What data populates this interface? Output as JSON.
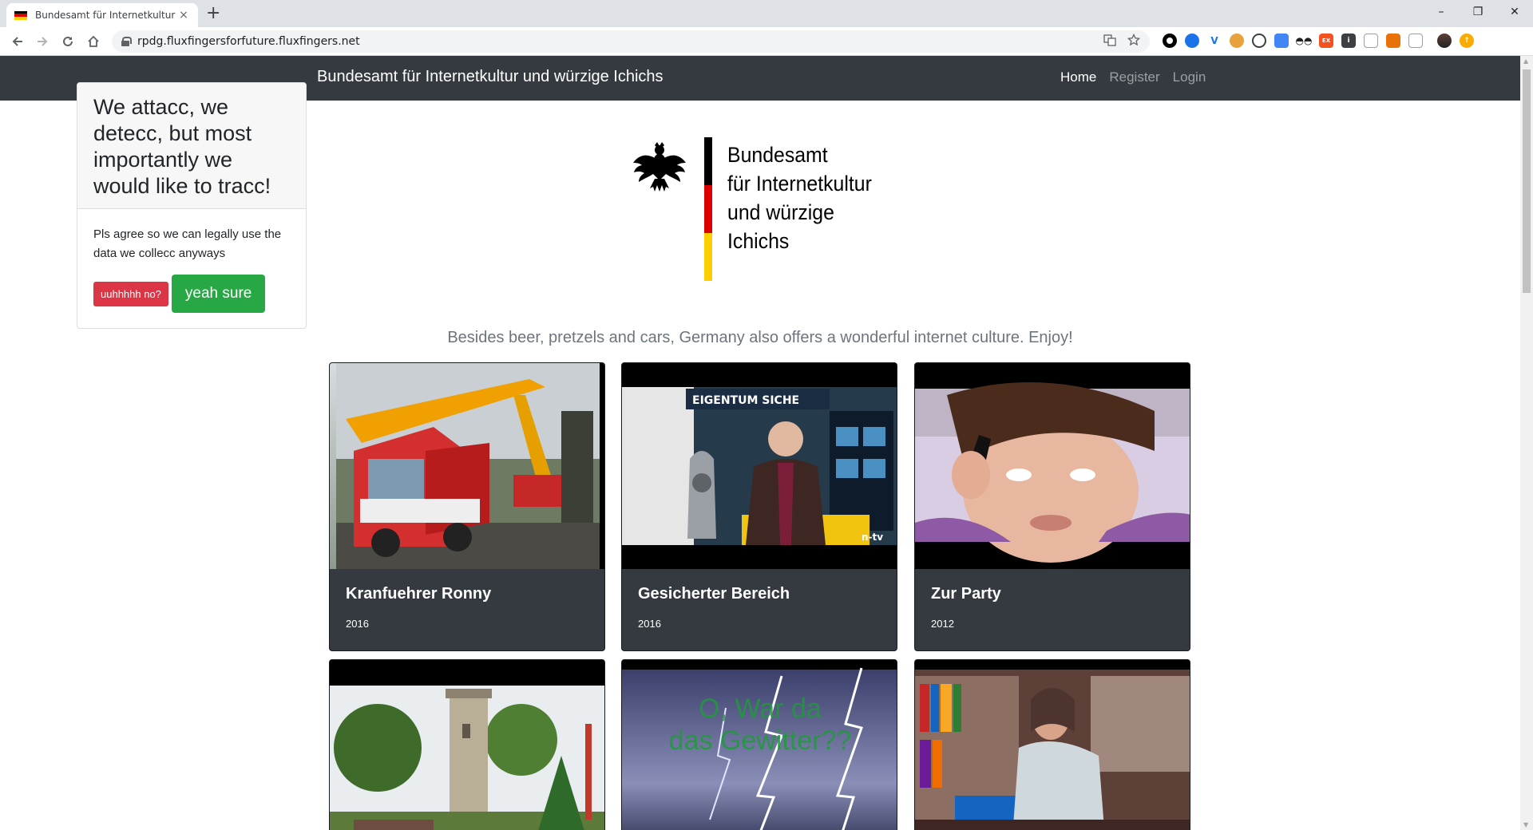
{
  "browser": {
    "tab_title": "Bundesamt für Internetkultur und würzige Ichichs",
    "tab_close": "×",
    "new_tab": "+",
    "url": "rpdg.fluxfingersforfuture.fluxfingers.net",
    "nav_icons": [
      "back-icon",
      "forward-icon",
      "reload-icon",
      "home-icon"
    ],
    "omnibox_icons": [
      "translate-icon",
      "bookmark-star-icon"
    ],
    "extensions": [
      {
        "name": "extension-circle-icon",
        "color": "#000000",
        "label": "○"
      },
      {
        "name": "extension-blue-circle-icon",
        "color": "#1a73e8",
        "label": "◉"
      },
      {
        "name": "extension-v-icon",
        "color": "#1a73e8",
        "label": "V"
      },
      {
        "name": "extension-cookie-icon",
        "color": "#e8a23b",
        "label": "●"
      },
      {
        "name": "extension-gear-icon",
        "color": "#3c4043",
        "label": "⚙"
      },
      {
        "name": "extension-translate-icon",
        "color": "#4285f4",
        "label": "G"
      },
      {
        "name": "extension-glasses-icon",
        "color": "#202124",
        "label": "◓"
      },
      {
        "name": "extension-ex-icon",
        "color": "#f4511e",
        "label": "EX"
      },
      {
        "name": "extension-info-icon",
        "color": "#3c4043",
        "label": "i"
      },
      {
        "name": "extension-card-icon",
        "color": "#9aa0a6",
        "label": "▭"
      },
      {
        "name": "extension-pdf-icon",
        "color": "#e8710a",
        "label": "▮"
      },
      {
        "name": "extension-screen-icon",
        "color": "#9aa0a6",
        "label": "▣"
      },
      {
        "name": "profile-avatar-icon",
        "color": "#5d4037",
        "label": "●"
      },
      {
        "name": "update-icon",
        "color": "#f9ab00",
        "label": "↑"
      }
    ],
    "window_controls": [
      "–",
      "❐",
      "✕"
    ]
  },
  "navbar": {
    "brand": "Bundesamt für Internetkultur und würzige Ichichs",
    "links": [
      {
        "label": "Home",
        "active": true
      },
      {
        "label": "Register",
        "active": false
      },
      {
        "label": "Login",
        "active": false
      }
    ]
  },
  "cookie_banner": {
    "heading": "We attacc, we detecc, but most importantly we would like to tracc!",
    "text": "Pls agree so we can legally use the data we collecc anyways",
    "decline_label": "uuhhhhh no?",
    "accept_label": "yeah sure"
  },
  "logo": {
    "line1": "Bundesamt",
    "line2": "für Internetkultur",
    "line3": "und würzige",
    "line4": "Ichichs",
    "colors": {
      "black": "#000000",
      "red": "#dd0000",
      "gold": "#ffce00"
    }
  },
  "tagline": "Besides beer, pretzels and cars, Germany also offers a wonderful internet culture. Enjoy!",
  "videos": [
    {
      "title": "Kranfuehrer Ronny",
      "year": "2016"
    },
    {
      "title": "Gesicherter Bereich",
      "year": "2016"
    },
    {
      "title": "Zur Party",
      "year": "2012"
    },
    {
      "title": "",
      "year": ""
    },
    {
      "title": "",
      "year": ""
    },
    {
      "title": "",
      "year": ""
    }
  ],
  "thumbnail_overlays": {
    "video2_banner": "EIGENTUM SICHE",
    "video2_channel": "n-tv",
    "video5_text": "O, War da das Gewitter??"
  }
}
